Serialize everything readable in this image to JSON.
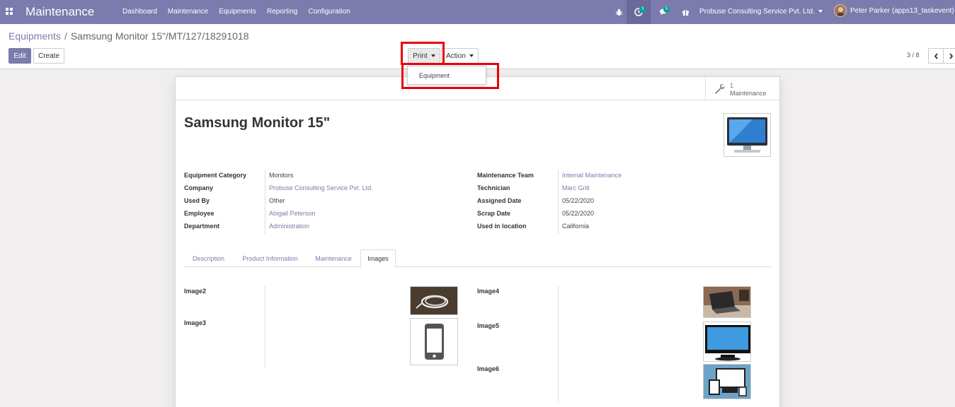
{
  "navbar": {
    "app_title": "Maintenance",
    "menu": [
      "Dashboard",
      "Maintenance",
      "Equipments",
      "Reporting",
      "Configuration"
    ],
    "activity_count": "3",
    "message_count": "5",
    "company": "Probuse Consulting Service Pvt. Ltd.",
    "user": "Peter Parker (apps13_taskevent)",
    "bar_color": "#7c7bad"
  },
  "breadcrumb": {
    "parent": "Equipments",
    "separator": "/",
    "current": "Samsung Monitor 15\"/MT/127/18291018"
  },
  "buttons": {
    "edit": "Edit",
    "create": "Create",
    "print": "Print",
    "action": "Action"
  },
  "print_menu": {
    "items": [
      "Equipment"
    ]
  },
  "pager": {
    "value": "3 / 8"
  },
  "smart_button": {
    "count": "1",
    "label": "Maintenance",
    "icon": "wrench-icon"
  },
  "record": {
    "name": "Samsung Monitor 15\"",
    "image_icon": "monitor-icon"
  },
  "fields_left": [
    {
      "label": "Equipment Category",
      "value": "Monitors",
      "link": false
    },
    {
      "label": "Company",
      "value": "Probuse Consulting Service Pvt. Ltd.",
      "link": true
    },
    {
      "label": "Used By",
      "value": "Other",
      "link": false
    },
    {
      "label": "Employee",
      "value": "Abigail Peterson",
      "link": true
    },
    {
      "label": "Department",
      "value": "Administration",
      "link": true
    }
  ],
  "fields_right": [
    {
      "label": "Maintenance Team",
      "value": "Internal Maintenance",
      "link": true
    },
    {
      "label": "Technician",
      "value": "Marc Grill",
      "link": true
    },
    {
      "label": "Assigned Date",
      "value": "05/22/2020",
      "link": false
    },
    {
      "label": "Scrap Date",
      "value": "05/22/2020",
      "link": false
    },
    {
      "label": "Used in location",
      "value": "California",
      "link": false
    }
  ],
  "tabs": [
    "Description",
    "Product Information",
    "Maintenance",
    "Images"
  ],
  "active_tab": "Images",
  "images_left": [
    "Image2",
    "Image3"
  ],
  "images_right": [
    "Image4",
    "Image5",
    "Image6"
  ],
  "highlight_color": "#e8000b"
}
